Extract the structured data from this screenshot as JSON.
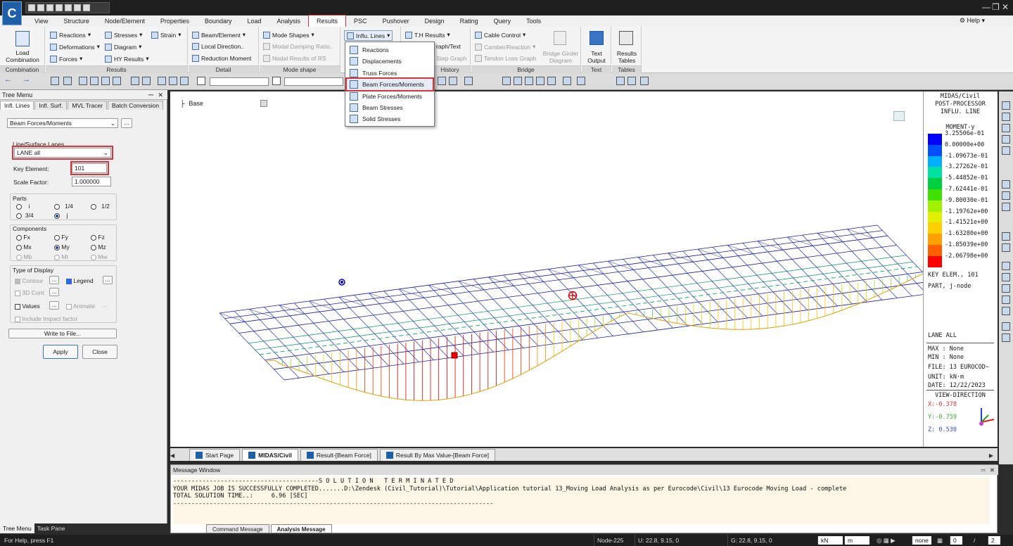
{
  "app": {
    "logo": "C"
  },
  "menu_tabs": [
    "View",
    "Structure",
    "Node/Element",
    "Properties",
    "Boundary",
    "Load",
    "Analysis",
    "Results",
    "PSC",
    "Pushover",
    "Design",
    "Rating",
    "Query",
    "Tools"
  ],
  "help": "Help",
  "ribbon": {
    "combination": {
      "label": "Load\nCombination",
      "group": "Combination"
    },
    "results": {
      "items": [
        "Reactions",
        "Deformations",
        "Forces",
        "Stresses",
        "Diagram",
        "HY Results",
        "Strain"
      ],
      "group": "Results"
    },
    "detail": {
      "items": [
        "Beam/Element",
        "Local Direction..",
        "Reduction Moment"
      ],
      "group": "Detail"
    },
    "mode": {
      "items": [
        "Mode Shapes",
        "Modal Damping Ratio..",
        "Nodal Results of RS"
      ],
      "group": "Mode shape"
    },
    "infl": {
      "label": "Influ. Lines"
    },
    "th": {
      "items": [
        "T.H Results",
        "raph/Text",
        "Step Graph"
      ],
      "group": "History"
    },
    "bridge": {
      "items": [
        "Cable Control",
        "Camber/Reaction",
        "Tendon Loss Graph",
        "Bridge Girder\nDiagram"
      ],
      "group": "Bridge"
    },
    "text": {
      "label": "Text\nOutput",
      "group": "Text"
    },
    "tables": {
      "label": "Results\nTables",
      "group": "Tables"
    }
  },
  "dropdown": [
    "Reactions",
    "Displacements",
    "Truss Forces",
    "Beam Forces/Moments",
    "Plate Forces/Moments",
    "Beam Stresses",
    "Solid Stresses"
  ],
  "tree": {
    "title": "Tree Menu",
    "tabs": [
      "Infl. Lines",
      "Infl. Surf.",
      "MVL Tracer",
      "Batch Conversion"
    ],
    "type_select": "Beam Forces/Moments",
    "lanes_label": "Line/Surface Lanes",
    "lane": "LANE all",
    "key_element_label": "Key Element:",
    "key_element": "101",
    "scale_label": "Scale Factor:",
    "scale": "1.000000",
    "parts_label": "Parts",
    "parts": [
      "i",
      "1/4",
      "1/2",
      "3/4",
      "j"
    ],
    "components_label": "Components",
    "components": [
      "Fx",
      "Fy",
      "Fz",
      "Mx",
      "My",
      "Mz",
      "Mb",
      "Mt",
      "Mw"
    ],
    "display_label": "Type of Display",
    "display": [
      "Contour",
      "Legend",
      "3D Cont",
      "Values",
      "Animate",
      "Include Impact factor"
    ],
    "write_btn": "Write to File...",
    "apply": "Apply",
    "close": "Close",
    "bottom_tabs": [
      "Tree Menu",
      "Task Pane"
    ]
  },
  "view": {
    "base": "Base"
  },
  "legend": {
    "header": [
      "MIDAS/Civil",
      "POST-PROCESSOR",
      "INFLU. LINE"
    ],
    "quantity": "MOMENT-y",
    "values": [
      "3.25506e-01",
      "0.00000e+00",
      "-1.09673e-01",
      "-3.27262e-01",
      "-5.44852e-01",
      "-7.62441e-01",
      "-9.80030e-01",
      "-1.19762e+00",
      "-1.41521e+00",
      "-1.63280e+00",
      "-1.85039e+00",
      "-2.06798e+00"
    ],
    "colors": [
      "#0000ff",
      "#0050ff",
      "#00b0ff",
      "#00e0a0",
      "#00d040",
      "#40e000",
      "#a0f000",
      "#e0f000",
      "#ffd000",
      "#ffa000",
      "#ff6000",
      "#ff0000"
    ],
    "info": [
      "KEY ELEM., 101",
      "PART, j-node"
    ],
    "lane": "LANE ALL",
    "meta": [
      "MAX : None",
      "MIN : None",
      "FILE: 13 EUROCOD~",
      "UNIT: kN·m",
      "DATE: 12/22/2023"
    ],
    "viewdir": "VIEW-DIRECTION",
    "x": "X:-0.378",
    "y": "Y:-0.759",
    "z": "Z: 0.530"
  },
  "doc_tabs": [
    "Start Page",
    "MIDAS/Civil",
    "Result-[Beam Force]",
    "Result By Max Value-[Beam Force]"
  ],
  "message": {
    "title": "Message Window",
    "lines": [
      "----------------------------------------S O L U T I O N   T E R M I N A T E D",
      "YOUR MIDAS JOB IS SUCCESSFULLY COMPLETED.......D:\\Zendesk (Civil_Tutorial)\\Tutorial\\Application tutorial 13_Moving Load Analysis as per Eurocode\\Civil\\13 Eurocode Moving Load - complete",
      "TOTAL SOLUTION TIME..:     6.96 [SEC]",
      "----------------------------------------------------------------------------------------"
    ],
    "tabs": [
      "Command Message",
      "Analysis Message"
    ]
  },
  "status": {
    "help": "For Help, press F1",
    "node": "Node-225",
    "u": "U: 22.8, 9.15, 0",
    "g": "G: 22.8, 9.15, 0",
    "force": "kN",
    "len": "m",
    "none": "none",
    "n1": "0",
    "n2": "2"
  }
}
